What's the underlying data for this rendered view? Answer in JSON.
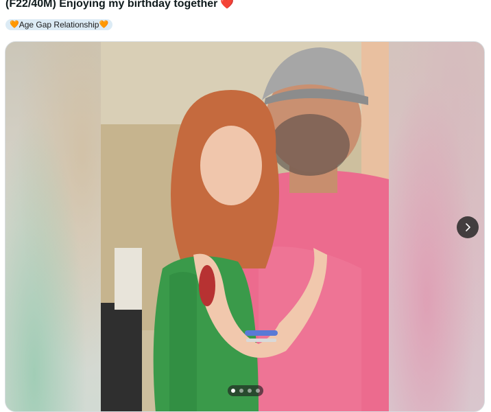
{
  "post": {
    "title": "(F22/40M) Enjoying my birthday together",
    "title_emoji": "❤️",
    "flair": {
      "text": "Age Gap Relationship",
      "emoji": "🧡",
      "background": "#dcebf5"
    }
  },
  "gallery": {
    "image_alt": "Photo of a couple smiling together",
    "current_index": 1,
    "total_images": 4,
    "next_icon": "chevron-right-icon"
  },
  "colors": {
    "title_text": "#0f1a1c",
    "heart": "#e0201e",
    "button_bg": "#282828",
    "dot_active": "#ffffff"
  }
}
